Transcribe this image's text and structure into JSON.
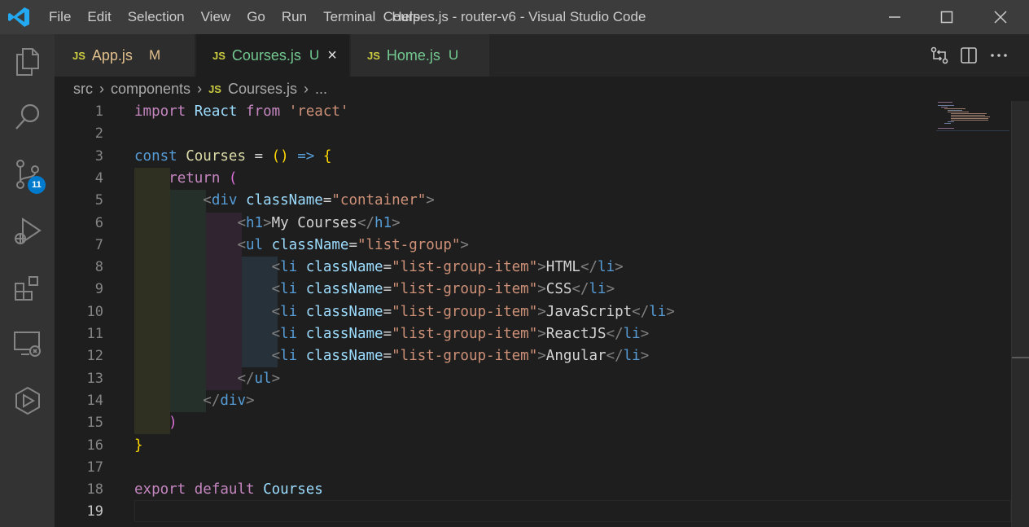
{
  "window": {
    "title": "Courses.js - router-v6 - Visual Studio Code",
    "menu": [
      "File",
      "Edit",
      "Selection",
      "View",
      "Go",
      "Run",
      "Terminal",
      "Help"
    ]
  },
  "activity_bar": {
    "items": [
      "explorer-icon",
      "search-icon",
      "source-control-icon",
      "run-debug-icon",
      "extensions-icon",
      "remote-explorer-icon",
      "deploy-icon"
    ],
    "source_control_badge": "11"
  },
  "tabs": [
    {
      "icon": "JS",
      "label": "App.js",
      "status": "M",
      "color": "#e2c08d",
      "active": false
    },
    {
      "icon": "JS",
      "label": "Courses.js",
      "status": "U",
      "color": "#73c991",
      "active": true,
      "close": "×"
    },
    {
      "icon": "JS",
      "label": "Home.js",
      "status": "U",
      "color": "#73c991",
      "active": false
    }
  ],
  "breadcrumb": {
    "segments": [
      "src",
      "components",
      "Courses.js",
      "..."
    ],
    "file_icon": "JS"
  },
  "editor": {
    "current_line": "19",
    "line_numbers": [
      "1",
      "2",
      "3",
      "4",
      "5",
      "6",
      "7",
      "8",
      "9",
      "10",
      "11",
      "12",
      "13",
      "14",
      "15",
      "16",
      "17",
      "18",
      "19"
    ],
    "lines": [
      "import React from 'react'",
      "",
      "const Courses = () => {",
      "    return (",
      "        <div className=\"container\">",
      "            <h1>My Courses</h1>",
      "            <ul className=\"list-group\">",
      "                <li className=\"list-group-item\">HTML</li>",
      "                <li className=\"list-group-item\">CSS</li>",
      "                <li className=\"list-group-item\">JavaScript</li>",
      "                <li className=\"list-group-item\">ReactJS</li>",
      "                <li className=\"list-group-item\">Angular</li>",
      "            </ul>",
      "        </div>",
      "    )",
      "}",
      "",
      "export default Courses",
      ""
    ]
  },
  "colors": {
    "accent": "#007acc",
    "modified": "#e2c08d",
    "untracked": "#73c991",
    "js_icon": "#cbcb41"
  }
}
